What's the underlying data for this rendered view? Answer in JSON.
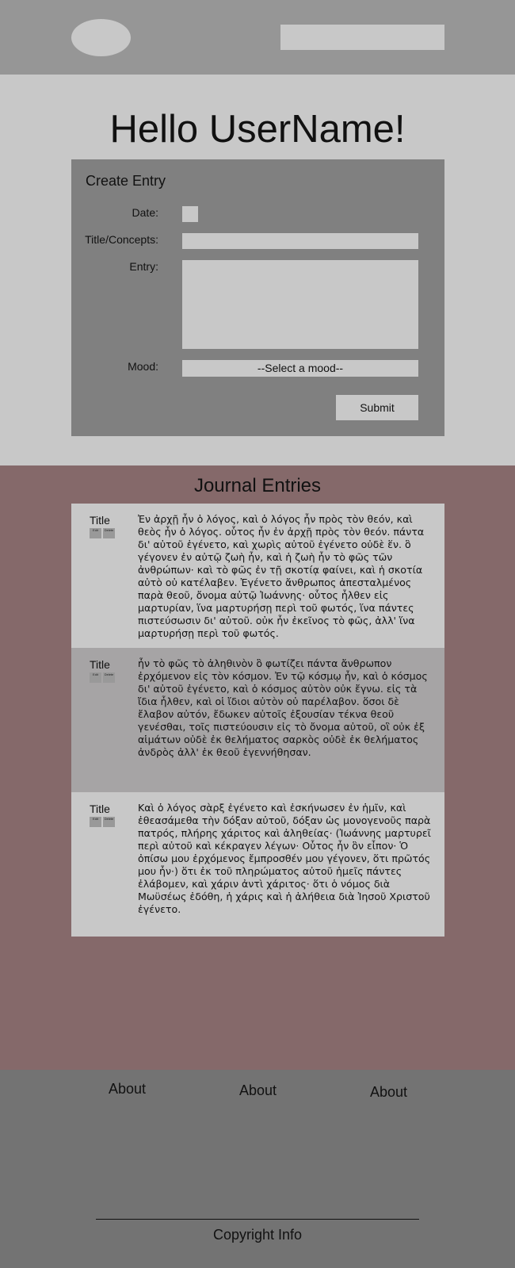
{
  "header": {
    "logo": "logo",
    "search_placeholder": ""
  },
  "hero": {
    "greeting": "Hello UserName!"
  },
  "create_entry": {
    "title": "Create Entry",
    "date_label": "Date:",
    "title_label": "Title/Concepts:",
    "entry_label": "Entry:",
    "mood_label": "Mood:",
    "mood_selected": "--Select a mood--",
    "submit_label": "Submit"
  },
  "journal": {
    "title": "Journal Entries",
    "entries": [
      {
        "title": "Title",
        "edit": "Edit",
        "delete": "Delete",
        "text": "Ἐν ἀρχῇ ἦν ὁ λόγος, καὶ ὁ λόγος ἦν πρὸς τὸν θεόν, καὶ θεὸς ἦν ὁ λόγος. οὗτος ἦν ἐν ἀρχῇ πρὸς τὸν θεόν. πάντα δι' αὐτοῦ ἐγένετο, καὶ χωρὶς αὐτοῦ ἐγένετο οὐδὲ ἕν. ὃ γέγονεν ἐν αὐτῷ ζωὴ ἦν, καὶ ἡ ζωὴ ἦν τὸ φῶς τῶν ἀνθρώπων· καὶ τὸ φῶς ἐν τῇ σκοτίᾳ φαίνει, καὶ ἡ σκοτία αὐτὸ οὐ κατέλαβεν. Ἐγένετο ἄνθρωπος ἀπεσταλμένος παρὰ θεοῦ, ὄνομα αὐτῷ Ἰωάννης· οὗτος ἦλθεν εἰς μαρτυρίαν, ἵνα μαρτυρήσῃ περὶ τοῦ φωτός, ἵνα πάντες πιστεύσωσιν δι' αὐτοῦ. οὐκ ἦν ἐκεῖνος τὸ φῶς, ἀλλ' ἵνα μαρτυρήσῃ περὶ τοῦ φωτός."
      },
      {
        "title": "Title",
        "edit": "Edit",
        "delete": "Delete",
        "text": "ἦν τὸ φῶς τὸ ἀληθινὸν ὃ φωτίζει πάντα ἄνθρωπον ἐρχόμενον εἰς τὸν κόσμον. Ἐν τῷ κόσμῳ ἦν, καὶ ὁ κόσμος δι' αὐτοῦ ἐγένετο, καὶ ὁ κόσμος αὐτὸν οὐκ ἔγνω. εἰς τὰ ἴδια ἦλθεν, καὶ οἱ ἴδιοι αὐτὸν οὐ παρέλαβον. ὅσοι δὲ ἔλαβον αὐτόν, ἔδωκεν αὐτοῖς ἐξουσίαν τέκνα θεοῦ γενέσθαι, τοῖς πιστεύουσιν εἰς τὸ ὄνομα αὐτοῦ, οἳ οὐκ ἐξ αἱμάτων οὐδὲ ἐκ θελήματος σαρκὸς οὐδὲ ἐκ θελήματος ἀνδρὸς ἀλλ' ἐκ θεοῦ ἐγεννήθησαν."
      },
      {
        "title": "Title",
        "edit": "Edit",
        "delete": "Delete",
        "text": "Καὶ ὁ λόγος σὰρξ ἐγένετο καὶ ἐσκήνωσεν ἐν ἡμῖν, καὶ ἐθεασάμεθα τὴν δόξαν αὐτοῦ, δόξαν ὡς μονογενοῦς παρὰ πατρός, πλήρης χάριτος καὶ ἀληθείας· (Ἰωάννης μαρτυρεῖ περὶ αὐτοῦ καὶ κέκραγεν λέγων· Οὗτος ἦν ὃν εἶπον· Ὁ ὀπίσω μου ἐρχόμενος ἔμπροσθέν μου γέγονεν, ὅτι πρῶτός μου ἦν·) ὅτι ἐκ τοῦ πληρώματος αὐτοῦ ἡμεῖς πάντες ἐλάβομεν, καὶ χάριν ἀντὶ χάριτος· ὅτι ὁ νόμος διὰ Μωϋσέως ἐδόθη, ἡ χάρις καὶ ἡ ἀλήθεια διὰ Ἰησοῦ Χριστοῦ ἐγένετο."
      }
    ]
  },
  "footer": {
    "links": [
      "About",
      "About",
      "About"
    ],
    "copyright": "Copyright Info"
  }
}
